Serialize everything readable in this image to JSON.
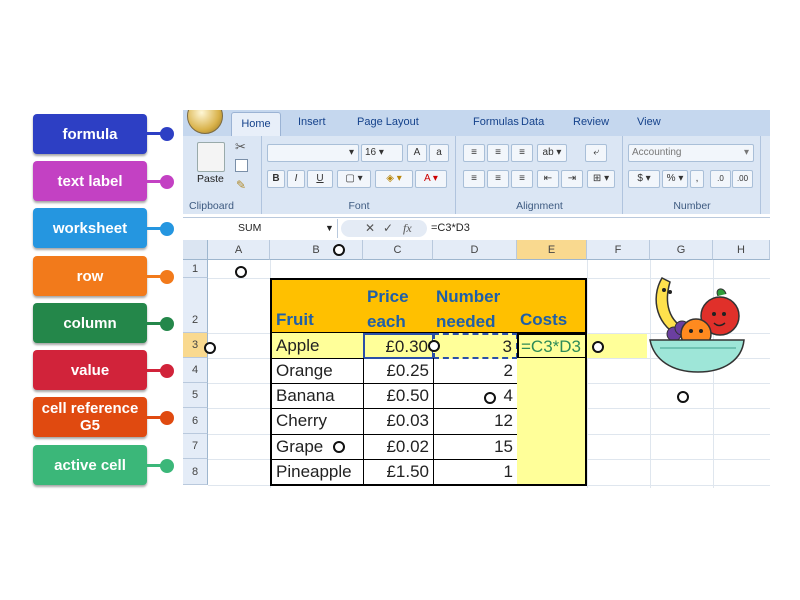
{
  "labels": [
    {
      "text": "formula",
      "color": "#2d3fc4",
      "dot": "#2d3fc4"
    },
    {
      "text": "text label",
      "color": "#c341c3",
      "dot": "#c341c3"
    },
    {
      "text": "worksheet",
      "color": "#2596e0",
      "dot": "#2596e0"
    },
    {
      "text": "row",
      "color": "#f27a1b",
      "dot": "#f27a1b"
    },
    {
      "text": "column",
      "color": "#24874a",
      "dot": "#24874a"
    },
    {
      "text": "value",
      "color": "#d1233a",
      "dot": "#d1233a"
    },
    {
      "text": "cell reference G5",
      "color": "#e04a10",
      "dot": "#e04a10"
    },
    {
      "text": "active cell",
      "color": "#3bb779",
      "dot": "#3bb779"
    }
  ],
  "ribbon": {
    "tabs": [
      "Home",
      "Insert",
      "Page Layout",
      "Formulas",
      "Data",
      "Review",
      "View"
    ],
    "groups": {
      "clipboard": "Clipboard",
      "font": "Font",
      "alignment": "Alignment",
      "number": "Number"
    },
    "paste": "Paste",
    "font_size": "16",
    "number_format": "Accounting",
    "bold": "B",
    "italic": "I",
    "underline": "U",
    "percent": "%"
  },
  "formula_bar": {
    "name_box": "SUM",
    "content": "=C3*D3",
    "fx": "fx"
  },
  "columns": [
    "A",
    "B",
    "C",
    "D",
    "E",
    "F",
    "G",
    "H"
  ],
  "rows": [
    "1",
    "2",
    "3",
    "4",
    "5",
    "6",
    "7",
    "8"
  ],
  "table": {
    "headers": {
      "fruit": "Fruit",
      "price1": "Price",
      "price2": "each",
      "num1": "Number",
      "num2": "needed",
      "costs": "Costs"
    },
    "rows": [
      {
        "fruit": "Apple",
        "price": "£0.30",
        "needed": "3",
        "cost": "=C3*D3"
      },
      {
        "fruit": "Orange",
        "price": "£0.25",
        "needed": "2",
        "cost": ""
      },
      {
        "fruit": "Banana",
        "price": "£0.50",
        "needed": "4",
        "cost": ""
      },
      {
        "fruit": "Cherry",
        "price": "£0.03",
        "needed": "12",
        "cost": ""
      },
      {
        "fruit": "Grape",
        "price": "£0.02",
        "needed": "15",
        "cost": ""
      },
      {
        "fruit": "Pineapple",
        "price": "£1.50",
        "needed": "1",
        "cost": ""
      }
    ]
  },
  "colors": {
    "header_fill": "#ffc000",
    "highlight_fill": "#ffff99",
    "header_text": "#1f5fa8",
    "formula_text": "#2e8b57"
  }
}
